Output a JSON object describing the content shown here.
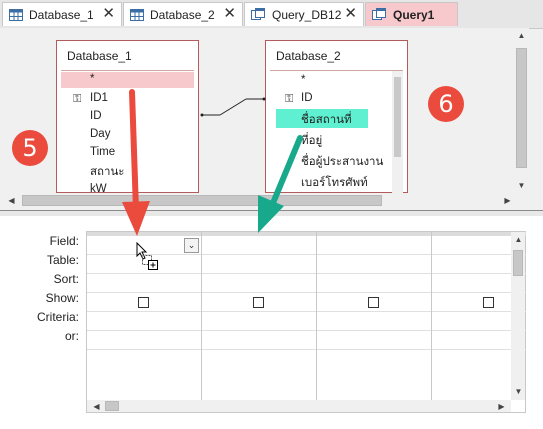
{
  "tabs": [
    {
      "label": "Database_1",
      "icon": "table-icon",
      "active": false
    },
    {
      "label": "Database_2",
      "icon": "table-icon",
      "active": false
    },
    {
      "label": "Query_DB12",
      "icon": "query-icon",
      "active": false
    },
    {
      "label": "Query1",
      "icon": "query-icon",
      "active": true
    }
  ],
  "tables": {
    "db1": {
      "title": "Database_1",
      "fields": [
        "*",
        "ID1",
        "ID",
        "Day",
        "Time",
        "สถานะ",
        "kW"
      ]
    },
    "db2": {
      "title": "Database_2",
      "fields": [
        "*",
        "ID",
        "ชื่อสถานที่",
        "ที่อยู่",
        "ชื่อผู้ประสานงาน",
        "เบอร์โทรศัพท์"
      ]
    }
  },
  "grid": {
    "row_labels": [
      "Field:",
      "Table:",
      "Sort:",
      "Show:",
      "Criteria:",
      "or:"
    ]
  },
  "annotations": {
    "badge_left": "5",
    "badge_right": "6",
    "arrow_red_color": "#ea4b3c",
    "arrow_green_color": "#18a98c"
  },
  "colors": {
    "active_tab": "#f7c9cc",
    "selected_field": "#f7c9cc",
    "highlight_field": "#5ef0d0"
  }
}
